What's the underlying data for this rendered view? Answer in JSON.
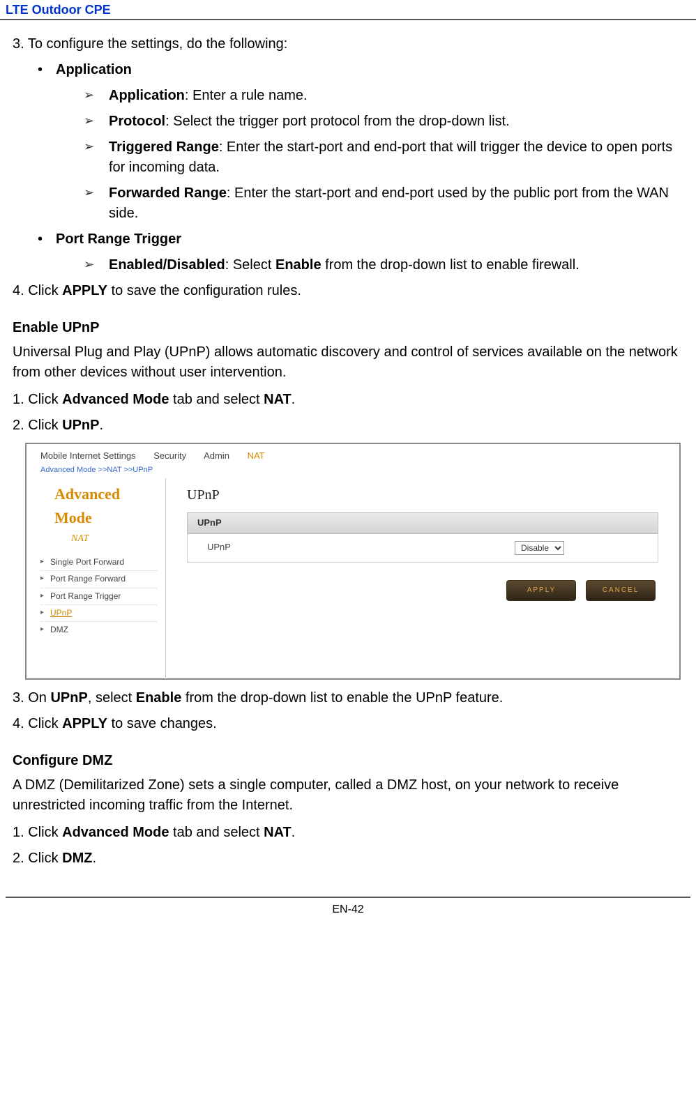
{
  "header": {
    "title": "LTE Outdoor CPE"
  },
  "section1": {
    "step3": "3.  To configure the settings, do the following:",
    "applicationHeader": "Application",
    "items": {
      "app_label": "Application",
      "app_desc": ": Enter a rule name.",
      "proto_label": "Protocol",
      "proto_desc": ": Select the trigger port protocol from the drop-down list.",
      "trig_label": "Triggered Range",
      "trig_desc": ": Enter the start-port and end-port that will trigger the device to open ports for incoming data.",
      "fwd_label": "Forwarded Range",
      "fwd_desc": ": Enter the start-port and end-port used by the public port from the WAN side."
    },
    "prtHeader": "Port Range Trigger",
    "prt": {
      "ed_label": "Enabled/Disabled",
      "ed_desc_pre": ": Select ",
      "ed_desc_bold": "Enable",
      "ed_desc_post": " from the drop-down list to enable firewall."
    },
    "step4_pre": "4.  Click ",
    "step4_bold": "APPLY",
    "step4_post": " to save the configuration rules."
  },
  "upnp": {
    "title": "Enable UPnP",
    "para": "Universal Plug and Play (UPnP) allows automatic discovery and control of services available on the network from other devices without user intervention.",
    "step1_pre": "1.  Click ",
    "step1_bold1": "Advanced Mode",
    "step1_mid": " tab and select ",
    "step1_bold2": "NAT",
    "step1_post": ".",
    "step2_pre": "2.  Click ",
    "step2_bold": "UPnP",
    "step2_post": ".",
    "step3_pre": "3.  On ",
    "step3_b1": "UPnP",
    "step3_mid": ", select ",
    "step3_b2": "Enable",
    "step3_post": " from the drop-down list to enable the UPnP feature.",
    "step4_pre": "4.  Click ",
    "step4_bold": "APPLY",
    "step4_post": " to save changes."
  },
  "screenshot": {
    "tabs": {
      "t1": "Mobile Internet Settings",
      "t2": "Security",
      "t3": "Admin",
      "t4": "NAT"
    },
    "breadcrumb": "Advanced Mode >>NAT >>UPnP",
    "modeTitle1": "Advanced",
    "modeTitle2": "Mode",
    "nat": "NAT",
    "menu": {
      "m1": "Single Port Forward",
      "m2": "Port Range Forward",
      "m3": "Port Range Trigger",
      "m4": "UPnP",
      "m5": "DMZ"
    },
    "panelTitle": "UPnP",
    "panelHead": "UPnP",
    "rowLabel": "UPnP",
    "selectValue": "Disable",
    "btnApply": "APPLY",
    "btnCancel": "CANCEL"
  },
  "dmz": {
    "title": "Configure DMZ",
    "para": "A DMZ (Demilitarized Zone) sets a single computer, called a DMZ host, on your network to receive unrestricted incoming traffic from the Internet.",
    "step1_pre": "1.  Click ",
    "step1_bold1": "Advanced Mode",
    "step1_mid": " tab and select ",
    "step1_bold2": "NAT",
    "step1_post": ".",
    "step2_pre": "2.  Click ",
    "step2_bold": "DMZ",
    "step2_post": "."
  },
  "footer": {
    "pageNum": "EN-42"
  }
}
